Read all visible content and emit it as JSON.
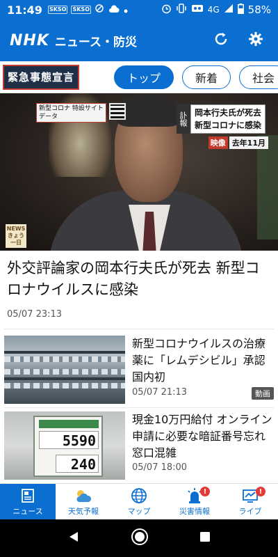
{
  "status_bar": {
    "time": "11:49",
    "mini_labels": [
      "SKSO",
      "SKSO"
    ],
    "network": "4G",
    "battery": "58%",
    "icon_names": [
      "alarm-icon",
      "vibrate-icon",
      "voicemail-icon",
      "signal-icon",
      "battery-icon"
    ]
  },
  "app_bar": {
    "logo": "NHK",
    "title": "ニュース・防災",
    "refresh_icon": "refresh-icon",
    "settings_icon": "gear-icon"
  },
  "tabs": {
    "emergency": "緊急事態宣言",
    "items": [
      {
        "label": "トップ",
        "active": true
      },
      {
        "label": "新着",
        "active": false
      },
      {
        "label": "社会",
        "active": false
      }
    ]
  },
  "hero": {
    "caption_label": "訃報",
    "caption_line1": "岡本行夫氏が死去",
    "caption_line2": "新型コロナに感染",
    "eizo_tag": "映像",
    "eizo_date": "去年11月",
    "topleft_line1": "新型コロナ 特設サイト",
    "topleft_line2": "データ",
    "news_label": "NEWS きょう一日"
  },
  "headline": {
    "title": "外交評論家の岡本行夫氏が死去 新型コロナウイルスに感染",
    "date": "05/07  23:13"
  },
  "articles": [
    {
      "title": "新型コロナウイルスの治療薬に「レムデシビル」承認 国内初",
      "date": "05/07  21:13",
      "badge": "動画"
    },
    {
      "title": "現金10万円給付 オンライン申請に必要な暗証番号忘れ窓口混雑",
      "date": "05/07  18:00",
      "sign_number": "5590",
      "sign_number2": "240"
    }
  ],
  "bottom_nav": [
    {
      "label": "ニュース",
      "icon": "news-icon",
      "active": true,
      "alert": false
    },
    {
      "label": "天気予報",
      "icon": "weather-icon",
      "active": false,
      "alert": false
    },
    {
      "label": "マップ",
      "icon": "globe-icon",
      "active": false,
      "alert": false
    },
    {
      "label": "災害情報",
      "icon": "siren-icon",
      "active": false,
      "alert": true
    },
    {
      "label": "ライブ",
      "icon": "live-tv-icon",
      "active": false,
      "alert": true
    }
  ],
  "alert_mark": "!",
  "colors": {
    "brand_blue": "#0a6fd1",
    "emergency_bg": "#1f2f48",
    "emergency_border": "#c0392b",
    "alert_red": "#e53935"
  }
}
